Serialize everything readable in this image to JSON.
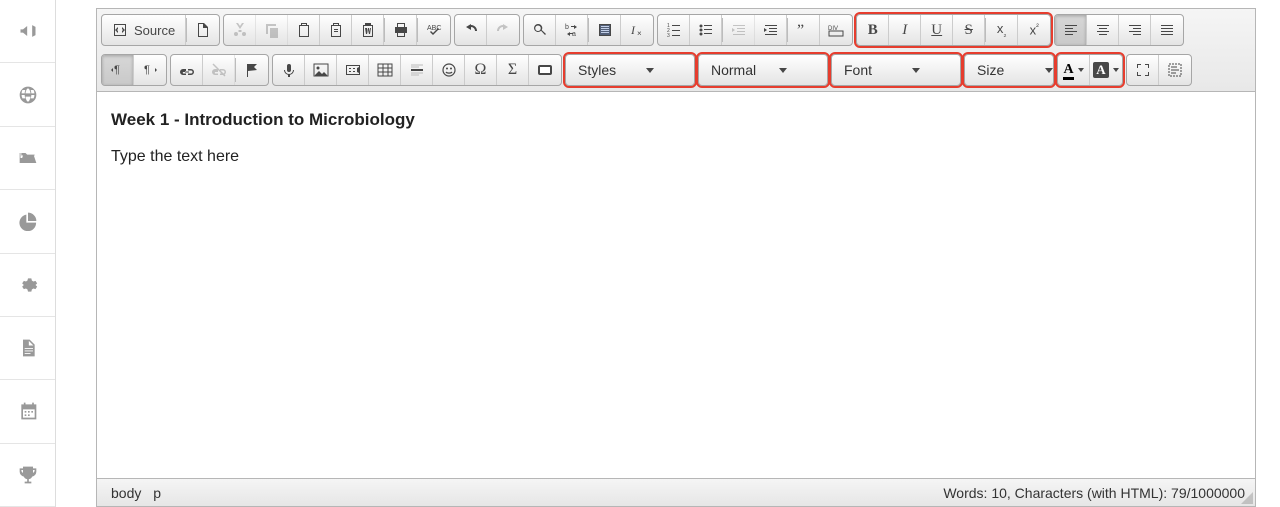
{
  "sidebar": {
    "items": [
      {
        "name": "announcements",
        "icon": "bullhorn-icon"
      },
      {
        "name": "globe",
        "icon": "globe-icon"
      },
      {
        "name": "files",
        "icon": "folder-open-icon"
      },
      {
        "name": "reports",
        "icon": "pie-chart-icon"
      },
      {
        "name": "settings",
        "icon": "gear-icon"
      },
      {
        "name": "documents",
        "icon": "file-icon"
      },
      {
        "name": "calendar",
        "icon": "calendar-icon"
      },
      {
        "name": "achievements",
        "icon": "trophy-icon"
      }
    ]
  },
  "toolbar": {
    "source_label": "Source",
    "combos": {
      "styles": "Styles",
      "format": "Normal",
      "font": "Font",
      "size": "Size"
    }
  },
  "content": {
    "heading": "Week 1 - Introduction to Microbiology",
    "paragraph": "Type the text here"
  },
  "statusbar": {
    "path": [
      "body",
      "p"
    ],
    "counter_label": "Words: 10, Characters (with HTML): 79/1000000"
  }
}
